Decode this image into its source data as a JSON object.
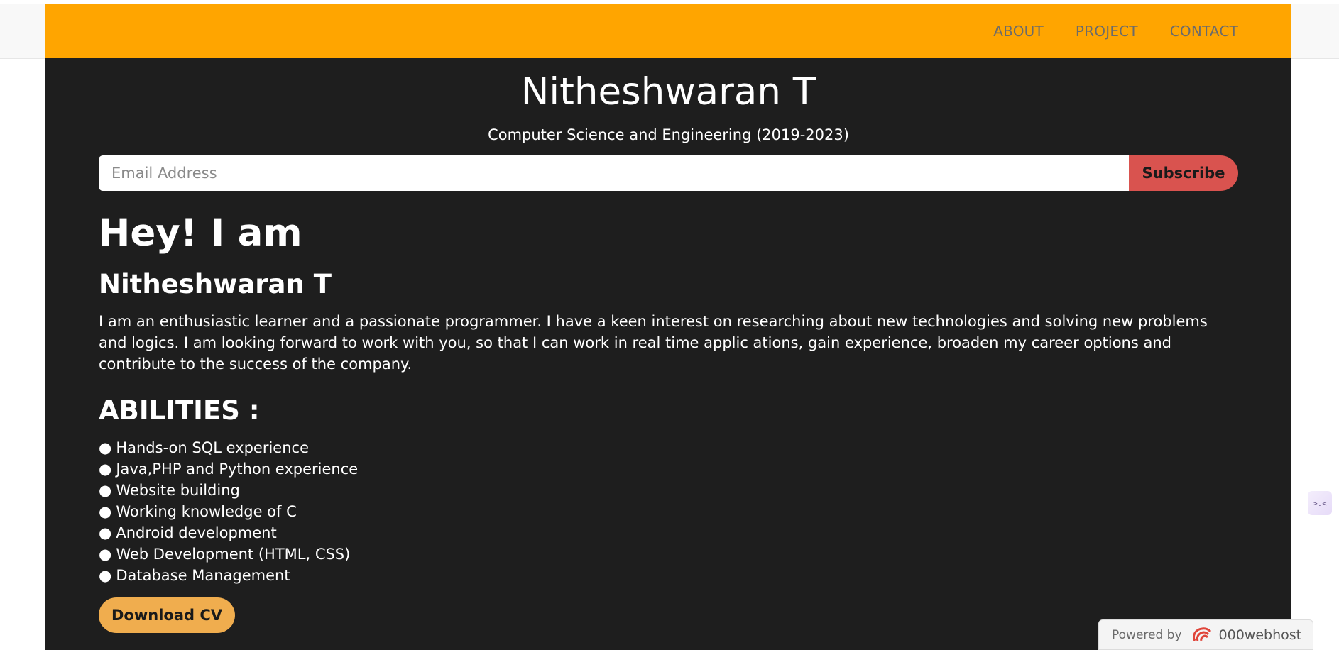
{
  "nav": {
    "links": [
      "ABOUT",
      "PROJECT",
      "CONTACT"
    ]
  },
  "header": {
    "title": "Nitheshwaran T",
    "subtitle": "Computer Science and Engineering (2019-2023)"
  },
  "subscribe": {
    "placeholder": "Email Address",
    "button_label": "Subscribe"
  },
  "intro": {
    "greeting": "Hey! I am",
    "name": "Nitheshwaran T",
    "bio": "I am an enthusiastic learner and a passionate programmer. I have a keen interest on researching about new technologies and solving new problems and logics. I am looking forward to work with you, so that I can work in real time applic ations, gain experience, broaden my career options and contribute to the success of the company."
  },
  "abilities": {
    "title": "ABILITIES :",
    "bullet": "●",
    "items": [
      "Hands-on SQL experience",
      "Java,PHP and Python experience",
      "Website building",
      "Working knowledge of C",
      "Android development",
      "Web Development (HTML, CSS)",
      "Database Management"
    ]
  },
  "download": {
    "label": "Download CV"
  },
  "widget": {
    "glyph": ">.<"
  },
  "footer": {
    "powered_label": "Powered by",
    "brand": "000webhost"
  },
  "colors": {
    "navbar": "#ffa500",
    "background": "#1e1e1e",
    "subscribe_button": "#d9534f",
    "download_button": "#f0ad4e",
    "nav_text": "#6b6b6b"
  }
}
